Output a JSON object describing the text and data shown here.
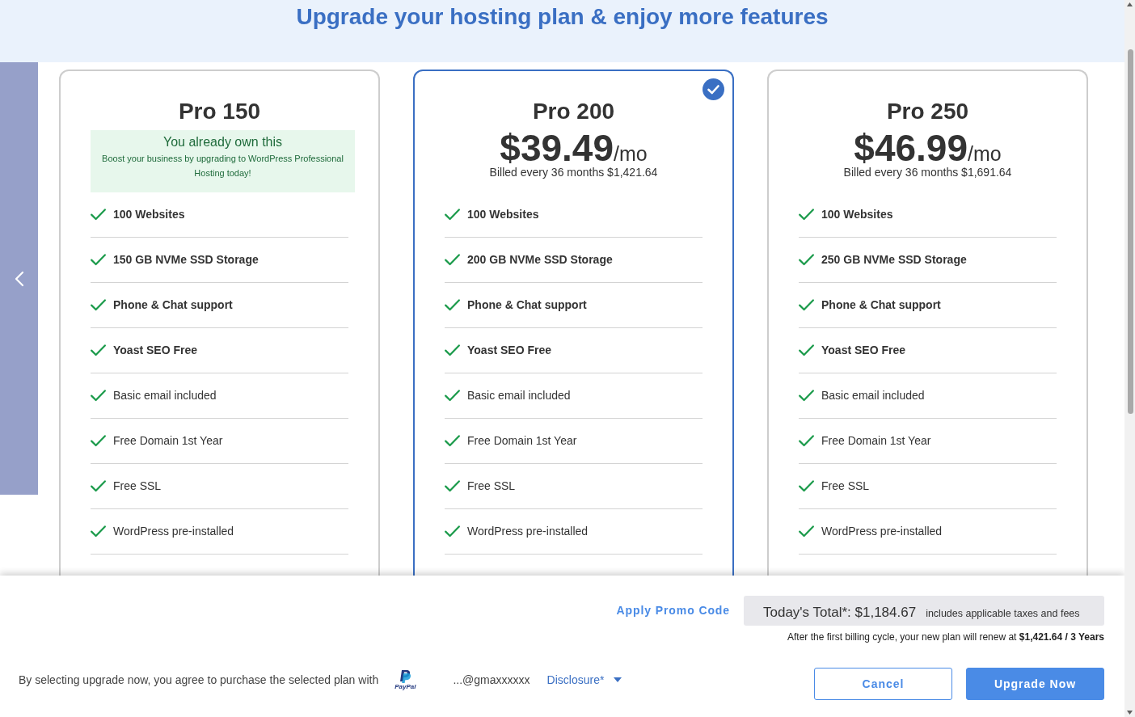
{
  "header": {
    "title": "Upgrade your hosting plan & enjoy more features"
  },
  "plans": [
    {
      "name": "Pro 150",
      "selected": false,
      "owned": true,
      "notice": {
        "title": "You already own this",
        "text": "Boost your business by upgrading to WordPress Professional Hosting today!"
      },
      "features": [
        {
          "text": "100 Websites",
          "bold": true
        },
        {
          "text": "150 GB NVMe SSD Storage",
          "bold": true
        },
        {
          "text": "Phone & Chat support",
          "bold": true
        },
        {
          "text": "Yoast SEO Free",
          "bold": true
        },
        {
          "text": "Basic email included",
          "bold": false
        },
        {
          "text": "Free Domain 1st Year",
          "bold": false
        },
        {
          "text": "Free SSL",
          "bold": false
        },
        {
          "text": "WordPress pre-installed",
          "bold": false
        }
      ]
    },
    {
      "name": "Pro 200",
      "selected": true,
      "owned": false,
      "price": "$39.49",
      "period": "/mo",
      "billing": "Billed every 36 months $1,421.64",
      "features": [
        {
          "text": "100 Websites",
          "bold": true
        },
        {
          "text": "200 GB NVMe SSD Storage",
          "bold": true
        },
        {
          "text": "Phone & Chat support",
          "bold": true
        },
        {
          "text": "Yoast SEO Free",
          "bold": true
        },
        {
          "text": "Basic email included",
          "bold": false
        },
        {
          "text": "Free Domain 1st Year",
          "bold": false
        },
        {
          "text": "Free SSL",
          "bold": false
        },
        {
          "text": "WordPress pre-installed",
          "bold": false
        }
      ]
    },
    {
      "name": "Pro 250",
      "selected": false,
      "owned": false,
      "price": "$46.99",
      "period": "/mo",
      "billing": "Billed every 36 months $1,691.64",
      "features": [
        {
          "text": "100 Websites",
          "bold": true
        },
        {
          "text": "250 GB NVMe SSD Storage",
          "bold": true
        },
        {
          "text": "Phone & Chat support",
          "bold": true
        },
        {
          "text": "Yoast SEO Free",
          "bold": true
        },
        {
          "text": "Basic email included",
          "bold": false
        },
        {
          "text": "Free Domain 1st Year",
          "bold": false
        },
        {
          "text": "Free SSL",
          "bold": false
        },
        {
          "text": "WordPress pre-installed",
          "bold": false
        }
      ]
    }
  ],
  "footer": {
    "promo_link": "Apply Promo Code",
    "total": "Today's Total*: $1,184.67",
    "total_note": "includes applicable taxes and fees",
    "renewal_note": "After the first billing cycle, your new plan will renew at **$1,421.64 / 3 Years**",
    "agreement": "By selecting upgrade now, you agree to purchase the selected plan with",
    "payment_method": "PayPal",
    "account": "...@gmaxxxxxx",
    "disclosure": "Disclosure*",
    "buttons": [
      {
        "label": "Cancel",
        "kind": "cancel"
      },
      {
        "label": "Upgrade Now",
        "kind": "submit"
      }
    ]
  }
}
